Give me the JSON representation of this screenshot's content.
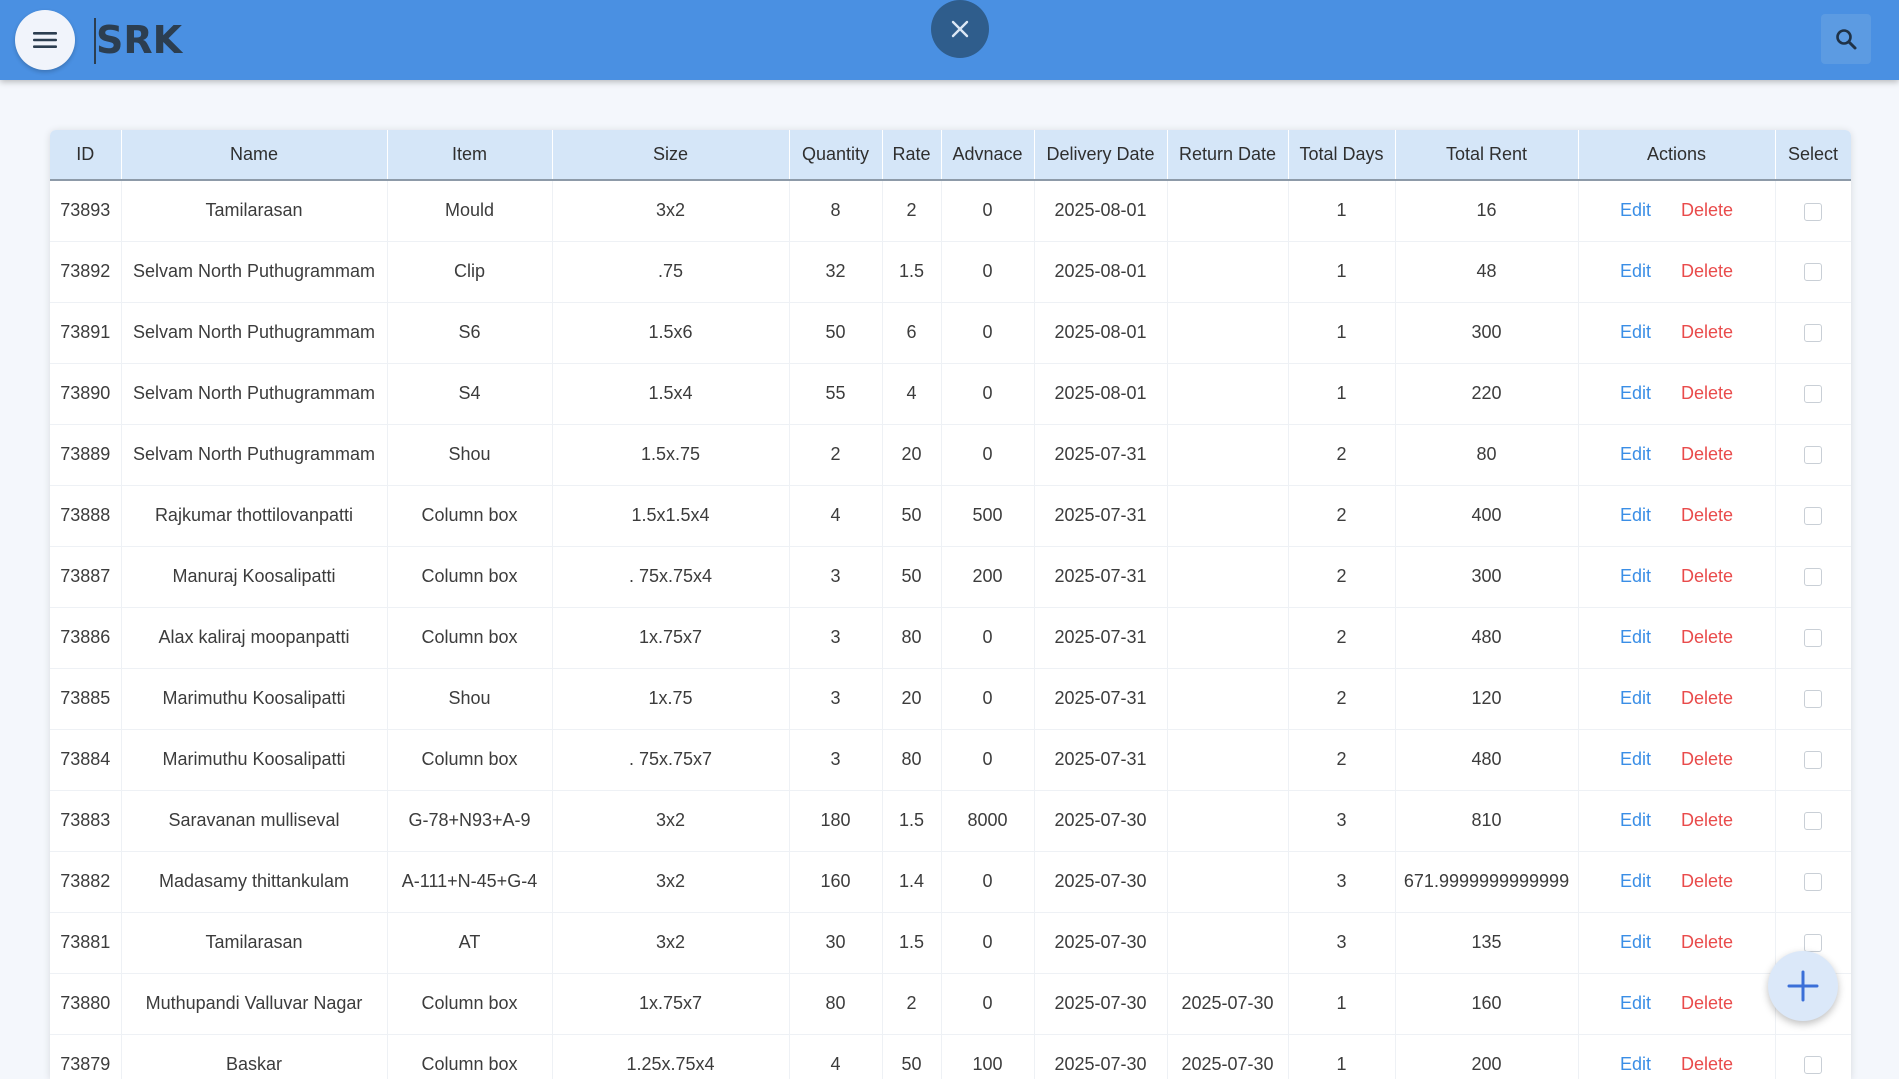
{
  "header": {
    "brand": "SRK",
    "menu_icon": "menu-icon",
    "close_icon": "close-icon",
    "search_icon": "search-icon",
    "colors": {
      "bar": "#4a90e2",
      "brand_text": "#2c3e50",
      "close_button": "#2f5d8c"
    }
  },
  "table": {
    "columns": [
      "ID",
      "Name",
      "Item",
      "Size",
      "Quantity",
      "Rate",
      "Advnace",
      "Delivery Date",
      "Return Date",
      "Total Days",
      "Total Rent",
      "Actions",
      "Select"
    ],
    "edit_label": "Edit",
    "delete_label": "Delete",
    "rows": [
      [
        "73893",
        "Tamilarasan",
        "Mould",
        "3x2",
        "8",
        "2",
        "0",
        "2025-08-01",
        "",
        "1",
        "16"
      ],
      [
        "73892",
        "Selvam North Puthugrammam",
        "Clip",
        ".75",
        "32",
        "1.5",
        "0",
        "2025-08-01",
        "",
        "1",
        "48"
      ],
      [
        "73891",
        "Selvam North Puthugrammam",
        "S6",
        "1.5x6",
        "50",
        "6",
        "0",
        "2025-08-01",
        "",
        "1",
        "300"
      ],
      [
        "73890",
        "Selvam North Puthugrammam",
        "S4",
        "1.5x4",
        "55",
        "4",
        "0",
        "2025-08-01",
        "",
        "1",
        "220"
      ],
      [
        "73889",
        "Selvam North Puthugrammam",
        "Shou",
        "1.5x.75",
        "2",
        "20",
        "0",
        "2025-07-31",
        "",
        "2",
        "80"
      ],
      [
        "73888",
        "Rajkumar thottilovanpatti",
        "Column box",
        "1.5x1.5x4",
        "4",
        "50",
        "500",
        "2025-07-31",
        "",
        "2",
        "400"
      ],
      [
        "73887",
        "Manuraj Koosalipatti",
        "Column box",
        ". 75x.75x4",
        "3",
        "50",
        "200",
        "2025-07-31",
        "",
        "2",
        "300"
      ],
      [
        "73886",
        "Alax kaliraj moopanpatti",
        "Column box",
        "1x.75x7",
        "3",
        "80",
        "0",
        "2025-07-31",
        "",
        "2",
        "480"
      ],
      [
        "73885",
        "Marimuthu Koosalipatti",
        "Shou",
        "1x.75",
        "3",
        "20",
        "0",
        "2025-07-31",
        "",
        "2",
        "120"
      ],
      [
        "73884",
        "Marimuthu Koosalipatti",
        "Column box",
        ". 75x.75x7",
        "3",
        "80",
        "0",
        "2025-07-31",
        "",
        "2",
        "480"
      ],
      [
        "73883",
        "Saravanan mulliseval",
        "G-78+N93+A-9",
        "3x2",
        "180",
        "1.5",
        "8000",
        "2025-07-30",
        "",
        "3",
        "810"
      ],
      [
        "73882",
        "Madasamy thittankulam",
        "A-111+N-45+G-4",
        "3x2",
        "160",
        "1.4",
        "0",
        "2025-07-30",
        "",
        "3",
        "671.9999999999999"
      ],
      [
        "73881",
        "Tamilarasan",
        "AT",
        "3x2",
        "30",
        "1.5",
        "0",
        "2025-07-30",
        "",
        "3",
        "135"
      ],
      [
        "73880",
        "Muthupandi Valluvar Nagar",
        "Column box",
        "1x.75x7",
        "80",
        "2",
        "0",
        "2025-07-30",
        "2025-07-30",
        "1",
        "160"
      ],
      [
        "73879",
        "Baskar",
        "Column box",
        "1.25x.75x4",
        "4",
        "50",
        "100",
        "2025-07-30",
        "2025-07-30",
        "1",
        "200"
      ]
    ]
  },
  "fab": {
    "icon": "plus-icon"
  }
}
